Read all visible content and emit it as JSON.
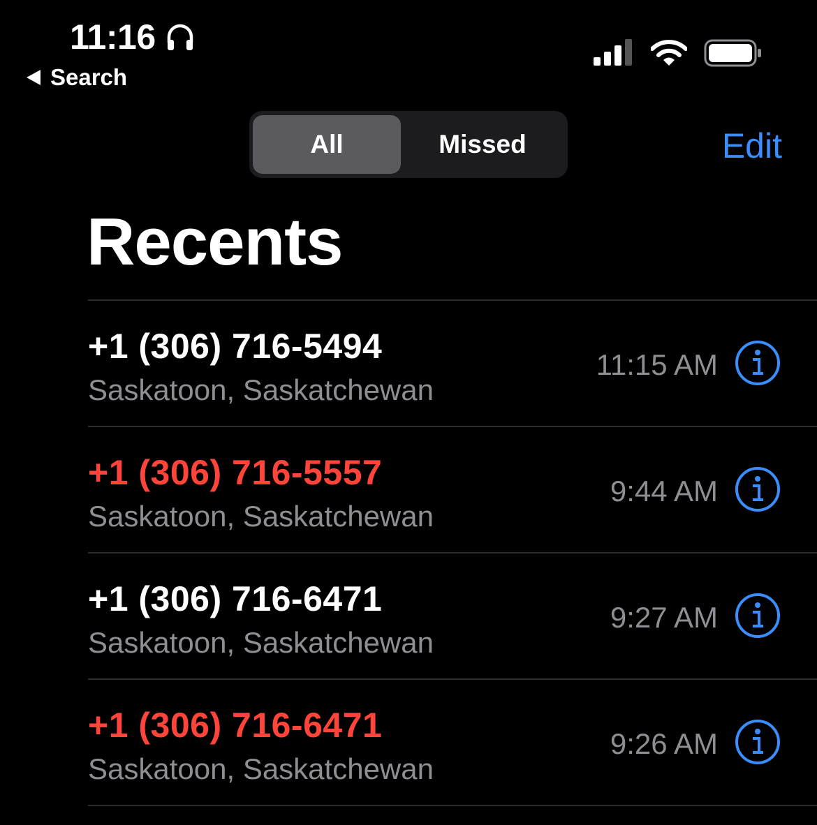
{
  "status_bar": {
    "time": "11:16",
    "back_label": "Search"
  },
  "segmented": {
    "options": [
      "All",
      "Missed"
    ],
    "selected": "All"
  },
  "edit_label": "Edit",
  "title": "Recents",
  "calls": [
    {
      "number": "+1 (306) 716-5494",
      "location": "Saskatoon, Saskatchewan",
      "time": "11:15 AM",
      "missed": false
    },
    {
      "number": "+1 (306) 716-5557",
      "location": "Saskatoon, Saskatchewan",
      "time": "9:44 AM",
      "missed": true
    },
    {
      "number": "+1 (306) 716-6471",
      "location": "Saskatoon, Saskatchewan",
      "time": "9:27 AM",
      "missed": false
    },
    {
      "number": "+1 (306) 716-6471",
      "location": "Saskatoon, Saskatchewan",
      "time": "9:26 AM",
      "missed": true
    }
  ],
  "colors": {
    "accent": "#3a8dfa",
    "missed": "#ff453a",
    "secondary_text": "#8e8e93",
    "background": "#000000"
  },
  "icons": [
    "headphones-icon",
    "back-triangle-icon",
    "cellular-signal-icon",
    "wifi-icon",
    "battery-icon",
    "info-icon"
  ]
}
